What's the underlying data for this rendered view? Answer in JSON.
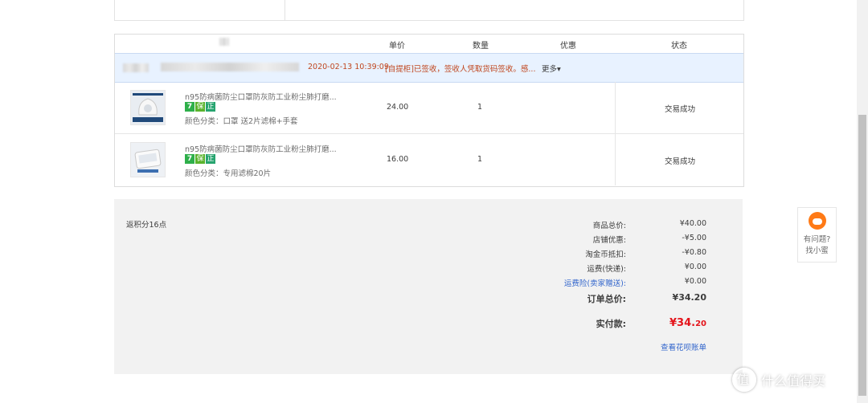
{
  "table": {
    "headers": {
      "price": "单价",
      "quantity": "数量",
      "discount": "优惠",
      "status": "状态"
    },
    "order": {
      "date": "2020-02-13 10:39:09",
      "message": "[自提柜]已签收，签收人凭取货码签收。感...",
      "more": "更多"
    },
    "items": [
      {
        "title": "n95防病菌防尘口罩防灰防工业粉尘肺打磨...",
        "tags": [
          "7",
          "保",
          "正"
        ],
        "spec": "颜色分类：口罩 送2片滤棉+手套",
        "price": "24.00",
        "quantity": "1",
        "status": "交易成功"
      },
      {
        "title": "n95防病菌防尘口罩防灰防工业粉尘肺打磨...",
        "tags": [
          "7",
          "保",
          "正"
        ],
        "spec": "颜色分类：专用滤棉20片",
        "price": "16.00",
        "quantity": "1",
        "status": "交易成功"
      }
    ]
  },
  "summary": {
    "points": "返积分16点",
    "rows": [
      {
        "label": "商品总价:",
        "value": "¥40.00"
      },
      {
        "label": "店铺优惠:",
        "value": "-¥5.00"
      },
      {
        "label": "淘金币抵扣:",
        "value": "-¥0.80"
      },
      {
        "label": "运费(快递):",
        "value": "¥0.00"
      },
      {
        "label": "运费险(卖家赠送):",
        "value": "¥0.00"
      }
    ],
    "total_label": "订单总价:",
    "total_value": "¥34.20",
    "paid_label": "实付款:",
    "paid_main": "¥34.",
    "paid_cents": "20",
    "huabei_link": "查看花呗账单"
  },
  "help": {
    "line1": "有问题?",
    "line2": "找小蜜"
  },
  "watermark": "什么值得买",
  "colors": {
    "accent_red": "#e4141b",
    "link_blue": "#3366cc",
    "order_row_bg": "#e8f2ff",
    "status_orange": "#c0461e"
  }
}
